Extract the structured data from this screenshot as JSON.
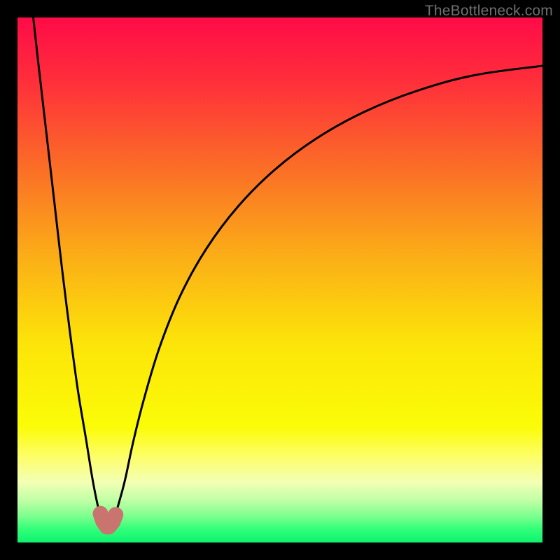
{
  "watermark": "TheBottleneck.com",
  "chart_data": {
    "type": "line",
    "title": "",
    "xlabel": "",
    "ylabel": "",
    "xlim": [
      0,
      100
    ],
    "ylim": [
      0,
      100
    ],
    "grid": false,
    "legend": false,
    "background": {
      "type": "vertical-gradient",
      "stops": [
        {
          "pos": 0.0,
          "color": "#ff0b47"
        },
        {
          "pos": 0.12,
          "color": "#ff2e3b"
        },
        {
          "pos": 0.28,
          "color": "#fb6b27"
        },
        {
          "pos": 0.45,
          "color": "#fbac17"
        },
        {
          "pos": 0.62,
          "color": "#fce409"
        },
        {
          "pos": 0.78,
          "color": "#fbfc08"
        },
        {
          "pos": 0.84,
          "color": "#fdfe6f"
        },
        {
          "pos": 0.885,
          "color": "#f3ffb5"
        },
        {
          "pos": 0.92,
          "color": "#c0ffa5"
        },
        {
          "pos": 0.95,
          "color": "#7cff8e"
        },
        {
          "pos": 0.975,
          "color": "#31ff79"
        },
        {
          "pos": 1.0,
          "color": "#0cf26f"
        }
      ]
    },
    "series": [
      {
        "name": "curve-left",
        "stroke": "#000000",
        "stroke_width": 3,
        "x": [
          3.0,
          4.0,
          5.5,
          7.0,
          8.5,
          10.0,
          11.5,
          13.0,
          14.3,
          15.3,
          15.8
        ],
        "y": [
          100,
          91,
          78,
          65,
          52,
          40,
          29,
          20,
          12,
          7,
          5.5
        ]
      },
      {
        "name": "curve-right",
        "stroke": "#000000",
        "stroke_width": 3,
        "x": [
          18.7,
          19.3,
          20.5,
          22.0,
          24.0,
          27.0,
          31.0,
          36.0,
          42.0,
          49.0,
          57.0,
          66.0,
          76.0,
          87.0,
          100.0
        ],
        "y": [
          5.5,
          7.5,
          12,
          19,
          27,
          37,
          47,
          56,
          64,
          71,
          77,
          82,
          86,
          89,
          90.8
        ]
      },
      {
        "name": "valley-marker",
        "type": "scatter",
        "stroke": "#c9746e",
        "fill": "#c9746e",
        "marker_size": 22,
        "x": [
          15.8,
          16.3,
          17.0,
          17.2,
          17.4,
          18.2,
          18.7
        ],
        "y": [
          5.5,
          4.0,
          3.0,
          3.6,
          3.0,
          4.0,
          5.3
        ]
      }
    ]
  }
}
